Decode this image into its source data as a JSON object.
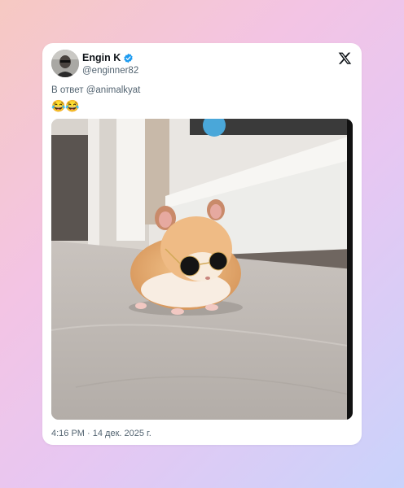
{
  "tweet": {
    "author_name": "Engin K",
    "author_handle": "@enginner82",
    "verified": true,
    "reply_text": "В ответ @animalkyat",
    "body_emoji": "😂😂",
    "timestamp": "4:16 PM · 14 дек. 2025 г.",
    "media_alt": "hamster-with-sunglasses-photo"
  },
  "icons": {
    "brand": "x-logo-icon",
    "verified": "verified-badge-icon"
  },
  "colors": {
    "card_bg": "#ffffff",
    "text_primary": "#0f1419",
    "text_secondary": "#536471",
    "verified_blue": "#1d9bf0"
  }
}
